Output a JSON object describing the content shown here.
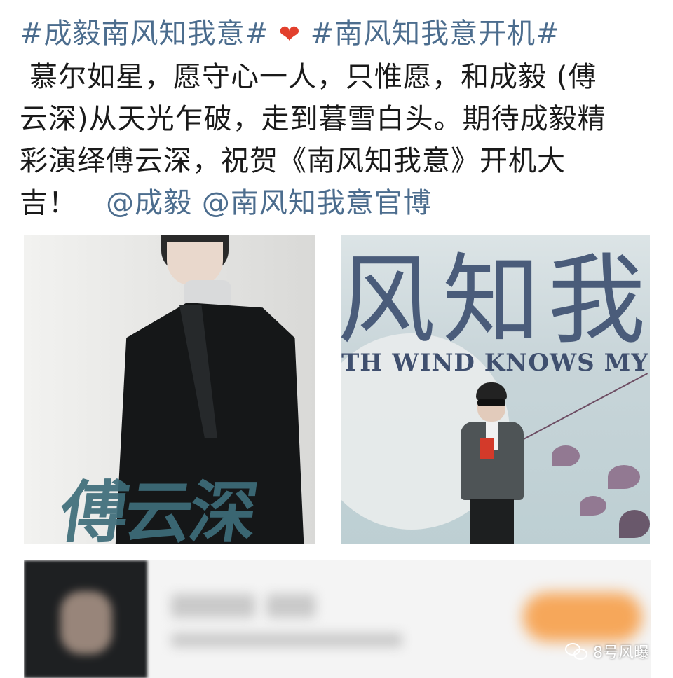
{
  "post": {
    "hashtag_1": "#成毅南风知我意#",
    "heart": "❤",
    "hashtag_2": "#南风知我意开机#",
    "body_line_1": "慕尔如星，愿守心一人，只惟愿，和成毅 (傅",
    "body_line_2": "云深)从天光乍破，走到暮雪白头。期待成毅精",
    "body_line_3": "彩演绎傅云深，祝贺《南风知我意》开机大",
    "body_line_4": "吉！",
    "mention_1": "@成毅",
    "mention_2": "@南风知我意官博"
  },
  "photos": {
    "left_caption": "傅云深",
    "right_poster_title": "风知我",
    "right_poster_subtitle": "TH WIND KNOWS MY MO"
  },
  "watermark": {
    "icon": "wechat-icon",
    "text": "8号风曝"
  },
  "colors": {
    "link": "#4c6d8e",
    "heart": "#e2402d"
  }
}
